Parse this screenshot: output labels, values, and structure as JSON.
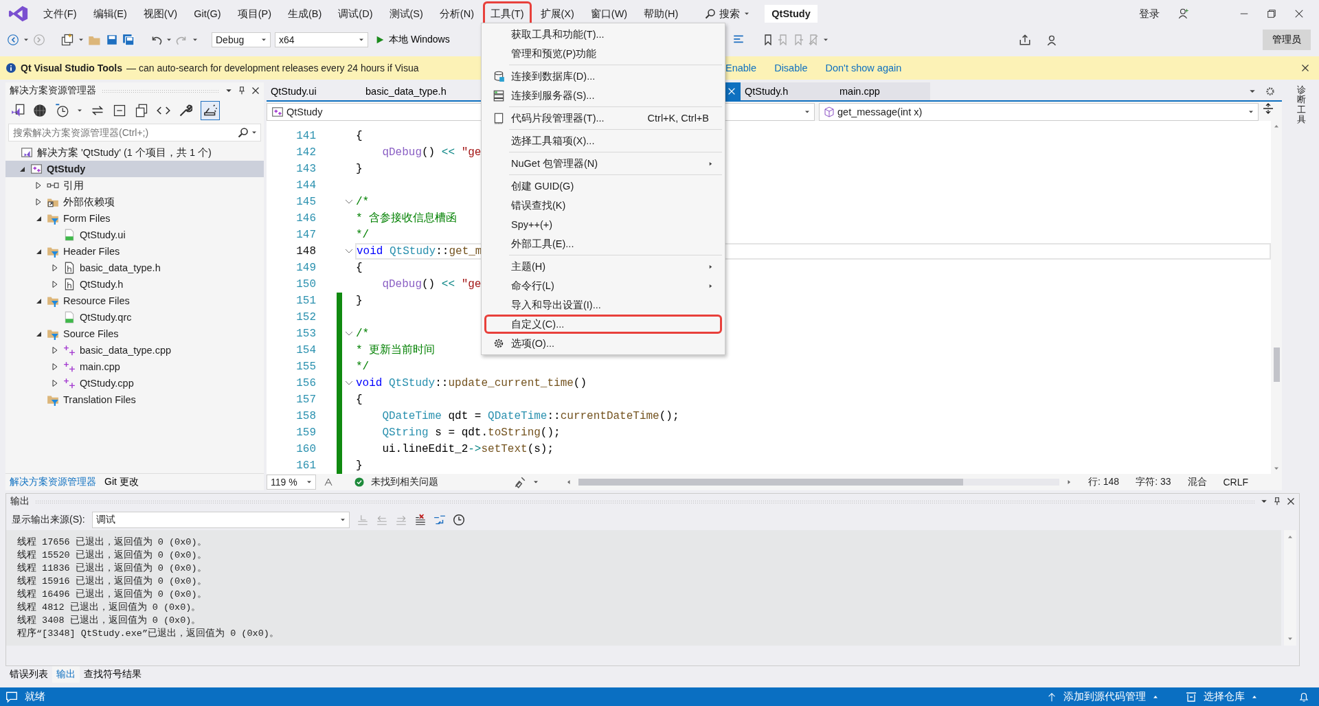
{
  "menubar": {
    "items": [
      {
        "label": "文件(F)",
        "highlighted": false
      },
      {
        "label": "编辑(E)",
        "highlighted": false
      },
      {
        "label": "视图(V)",
        "highlighted": false
      },
      {
        "label": "Git(G)",
        "highlighted": false
      },
      {
        "label": "项目(P)",
        "highlighted": false
      },
      {
        "label": "生成(B)",
        "highlighted": false
      },
      {
        "label": "调试(D)",
        "highlighted": false
      },
      {
        "label": "测试(S)",
        "highlighted": false
      },
      {
        "label": "分析(N)",
        "highlighted": false
      },
      {
        "label": "工具(T)",
        "highlighted": true
      },
      {
        "label": "扩展(X)",
        "highlighted": false
      },
      {
        "label": "窗口(W)",
        "highlighted": false
      },
      {
        "label": "帮助(H)",
        "highlighted": false
      }
    ],
    "search": "搜索",
    "title": "QtStudy",
    "signin": "登录"
  },
  "toolbar": {
    "configuration": "Debug",
    "platform": "x64",
    "run": "本地 Windows",
    "admin": "管理员"
  },
  "infobar": {
    "title": "Qt Visual Studio Tools",
    "message": "— can auto-search for development releases every 24 hours if Visua",
    "actions": [
      "Enable",
      "Disable",
      "Don't show again"
    ]
  },
  "solution_explorer": {
    "title": "解决方案资源管理器",
    "search": {
      "placeholder": "搜索解决方案资源管理器(Ctrl+;)"
    },
    "solution": "解决方案 'QtStudy' (1 个项目，共 1 个)",
    "tree": [
      {
        "label": "QtStudy",
        "kind": "project",
        "expanded": true,
        "selected": true,
        "children": [
          {
            "label": "引用",
            "kind": "references",
            "expanded": false,
            "selected": false
          },
          {
            "label": "外部依赖项",
            "kind": "external",
            "expanded": false,
            "selected": false
          },
          {
            "label": "Form Files",
            "kind": "filter",
            "expanded": true,
            "selected": false,
            "children": [
              {
                "label": "QtStudy.ui",
                "kind": "ui",
                "selected": false
              }
            ]
          },
          {
            "label": "Header Files",
            "kind": "filter",
            "expanded": true,
            "selected": false,
            "children": [
              {
                "label": "basic_data_type.h",
                "kind": "header",
                "expanded": false,
                "selected": false
              },
              {
                "label": "QtStudy.h",
                "kind": "header",
                "expanded": false,
                "selected": false
              }
            ]
          },
          {
            "label": "Resource Files",
            "kind": "filter",
            "expanded": true,
            "selected": false,
            "children": [
              {
                "label": "QtStudy.qrc",
                "kind": "qrc",
                "selected": false
              }
            ]
          },
          {
            "label": "Source Files",
            "kind": "filter",
            "expanded": true,
            "selected": false,
            "children": [
              {
                "label": "basic_data_type.cpp",
                "kind": "cpp",
                "expanded": false,
                "selected": false
              },
              {
                "label": "main.cpp",
                "kind": "cpp",
                "expanded": false,
                "selected": false
              },
              {
                "label": "QtStudy.cpp",
                "kind": "cpp",
                "expanded": false,
                "selected": false
              }
            ]
          },
          {
            "label": "Translation Files",
            "kind": "filter",
            "selected": false
          }
        ]
      }
    ],
    "tabs": [
      {
        "label": "解决方案资源管理器",
        "selected": true
      },
      {
        "label": "Git 更改",
        "selected": false
      }
    ]
  },
  "editor": {
    "tabs": [
      {
        "label": "QtStudy.ui",
        "selected": false
      },
      {
        "label": "basic_data_type.h",
        "selected": false
      },
      {
        "selected": true
      },
      {
        "label": "QtStudy.h",
        "selected": false
      },
      {
        "label": "main.cpp",
        "selected": false
      }
    ],
    "scope": "QtStudy",
    "member": "get_message(int x)",
    "lines": [
      {
        "number": "141",
        "fold": false,
        "changed": false,
        "current": false,
        "tokens": [
          {
            "text": "{",
            "kind": "plain"
          }
        ]
      },
      {
        "number": "142",
        "fold": false,
        "changed": false,
        "current": false,
        "tokens": [
          {
            "text": "    qDebug",
            "kind": "macro"
          },
          {
            "text": "() ",
            "kind": "plain"
          },
          {
            "text": "<<",
            "kind": "op"
          },
          {
            "text": " \"ge",
            "kind": "string"
          }
        ]
      },
      {
        "number": "143",
        "fold": false,
        "changed": false,
        "current": false,
        "tokens": [
          {
            "text": "}",
            "kind": "plain"
          }
        ]
      },
      {
        "number": "144",
        "fold": false,
        "changed": false,
        "current": false
      },
      {
        "number": "145",
        "fold": true,
        "changed": false,
        "current": false,
        "tokens": [
          {
            "text": "/*",
            "kind": "comment"
          }
        ]
      },
      {
        "number": "146",
        "fold": false,
        "changed": false,
        "current": false,
        "tokens": [
          {
            "text": "* 含参接收信息槽函",
            "kind": "comment"
          }
        ]
      },
      {
        "number": "147",
        "fold": false,
        "changed": false,
        "current": false,
        "tokens": [
          {
            "text": "*/",
            "kind": "comment"
          }
        ]
      },
      {
        "number": "148",
        "fold": true,
        "changed": false,
        "current": true,
        "tokens": [
          {
            "text": "void",
            "kind": "keyword"
          },
          {
            "text": " QtStudy",
            "kind": "type"
          },
          {
            "text": "::",
            "kind": "plain"
          },
          {
            "text": "get_m",
            "kind": "function"
          }
        ]
      },
      {
        "number": "149",
        "fold": false,
        "changed": false,
        "current": false,
        "tokens": [
          {
            "text": "{",
            "kind": "plain"
          }
        ]
      },
      {
        "number": "150",
        "fold": false,
        "changed": false,
        "current": false,
        "tokens": [
          {
            "text": "    qDebug",
            "kind": "macro"
          },
          {
            "text": "() ",
            "kind": "plain"
          },
          {
            "text": "<<",
            "kind": "op"
          },
          {
            "text": " \"ge",
            "kind": "string"
          }
        ]
      },
      {
        "number": "151",
        "fold": false,
        "changed": true,
        "current": false,
        "tokens": [
          {
            "text": "}",
            "kind": "plain"
          }
        ]
      },
      {
        "number": "152",
        "fold": false,
        "changed": true,
        "current": false
      },
      {
        "number": "153",
        "fold": true,
        "changed": true,
        "current": false,
        "tokens": [
          {
            "text": "/*",
            "kind": "comment"
          }
        ]
      },
      {
        "number": "154",
        "fold": false,
        "changed": true,
        "current": false,
        "tokens": [
          {
            "text": "* 更新当前时间",
            "kind": "comment"
          }
        ]
      },
      {
        "number": "155",
        "fold": false,
        "changed": true,
        "current": false,
        "tokens": [
          {
            "text": "*/",
            "kind": "comment"
          }
        ]
      },
      {
        "number": "156",
        "fold": true,
        "changed": true,
        "current": false,
        "tokens": [
          {
            "text": "void",
            "kind": "keyword"
          },
          {
            "text": " QtStudy",
            "kind": "type"
          },
          {
            "text": "::",
            "kind": "plain"
          },
          {
            "text": "update_current_time",
            "kind": "function"
          },
          {
            "text": "()",
            "kind": "plain"
          }
        ]
      },
      {
        "number": "157",
        "fold": false,
        "changed": true,
        "current": false,
        "tokens": [
          {
            "text": "{",
            "kind": "plain"
          }
        ]
      },
      {
        "number": "158",
        "fold": false,
        "changed": true,
        "current": false,
        "tokens": [
          {
            "text": "    QDateTime",
            "kind": "type"
          },
          {
            "text": " qdt = ",
            "kind": "plain"
          },
          {
            "text": "QDateTime",
            "kind": "type"
          },
          {
            "text": "::",
            "kind": "plain"
          },
          {
            "text": "currentDateTime",
            "kind": "function"
          },
          {
            "text": "();",
            "kind": "plain"
          }
        ]
      },
      {
        "number": "159",
        "fold": false,
        "changed": true,
        "current": false,
        "tokens": [
          {
            "text": "    QString",
            "kind": "type"
          },
          {
            "text": " s = qdt.",
            "kind": "plain"
          },
          {
            "text": "toString",
            "kind": "function"
          },
          {
            "text": "();",
            "kind": "plain"
          }
        ]
      },
      {
        "number": "160",
        "fold": false,
        "changed": true,
        "current": false,
        "tokens": [
          {
            "text": "    ui.lineEdit_2",
            "kind": "plain"
          },
          {
            "text": "->",
            "kind": "op"
          },
          {
            "text": "setText",
            "kind": "function"
          },
          {
            "text": "(s);",
            "kind": "plain"
          }
        ]
      },
      {
        "number": "161",
        "fold": false,
        "changed": true,
        "current": false,
        "tokens": [
          {
            "text": "}",
            "kind": "plain"
          }
        ]
      }
    ],
    "zoom": "119 %",
    "issues": "未找到相关问题",
    "position": {
      "line": "行: 148",
      "column": "字符: 33",
      "encoding": "混合",
      "eol": "CRLF"
    }
  },
  "tools_menu": {
    "items": [
      {
        "kind": "plain",
        "label": "获取工具和功能(T)...",
        "highlighted": false
      },
      {
        "kind": "plain",
        "label": "管理和预览(P)功能",
        "highlighted": false
      },
      {
        "kind": "separator"
      },
      {
        "kind": "database",
        "label": "连接到数据库(D)...",
        "highlighted": false
      },
      {
        "kind": "server",
        "label": "连接到服务器(S)...",
        "highlighted": false
      },
      {
        "kind": "separator"
      },
      {
        "kind": "snippet",
        "label": "代码片段管理器(T)...",
        "shortcut": "Ctrl+K, Ctrl+B",
        "highlighted": false
      },
      {
        "kind": "separator"
      },
      {
        "kind": "plain",
        "label": "选择工具箱项(X)...",
        "highlighted": false
      },
      {
        "kind": "separator"
      },
      {
        "kind": "submenu",
        "label": "NuGet 包管理器(N)",
        "highlighted": false
      },
      {
        "kind": "separator"
      },
      {
        "kind": "plain",
        "label": "创建 GUID(G)",
        "highlighted": false
      },
      {
        "kind": "plain",
        "label": "错误查找(K)",
        "highlighted": false
      },
      {
        "kind": "plain",
        "label": "Spy++(+)",
        "highlighted": false
      },
      {
        "kind": "plain",
        "label": "外部工具(E)...",
        "highlighted": false
      },
      {
        "kind": "separator"
      },
      {
        "kind": "submenu",
        "label": "主题(H)",
        "highlighted": false
      },
      {
        "kind": "submenu",
        "label": "命令行(L)",
        "highlighted": false
      },
      {
        "kind": "plain",
        "label": "导入和导出设置(I)...",
        "highlighted": false
      },
      {
        "kind": "plain",
        "label": "自定义(C)...",
        "highlighted": true
      },
      {
        "kind": "options",
        "label": "选项(O)...",
        "highlighted": false
      }
    ]
  },
  "side_strip": "诊断工具",
  "output": {
    "title": "输出",
    "source_label": "显示输出来源(S):",
    "source": "调试",
    "lines": [
      "线程 17656 已退出，返回值为 0 (0x0)。",
      "线程 15520 已退出，返回值为 0 (0x0)。",
      "线程 11836 已退出，返回值为 0 (0x0)。",
      "线程 15916 已退出，返回值为 0 (0x0)。",
      "线程 16496 已退出，返回值为 0 (0x0)。",
      "线程 4812 已退出，返回值为 0 (0x0)。",
      "线程 3408 已退出，返回值为 0 (0x0)。",
      "程序“[3348] QtStudy.exe”已退出，返回值为 0 (0x0)。"
    ],
    "tabs": [
      {
        "label": "错误列表",
        "selected": false
      },
      {
        "label": "输出",
        "selected": true
      },
      {
        "label": "查找符号结果",
        "selected": false
      }
    ]
  },
  "status_bar": {
    "state": "就绪",
    "source_control": "添加到源代码管理",
    "repository": "选择仓库"
  }
}
